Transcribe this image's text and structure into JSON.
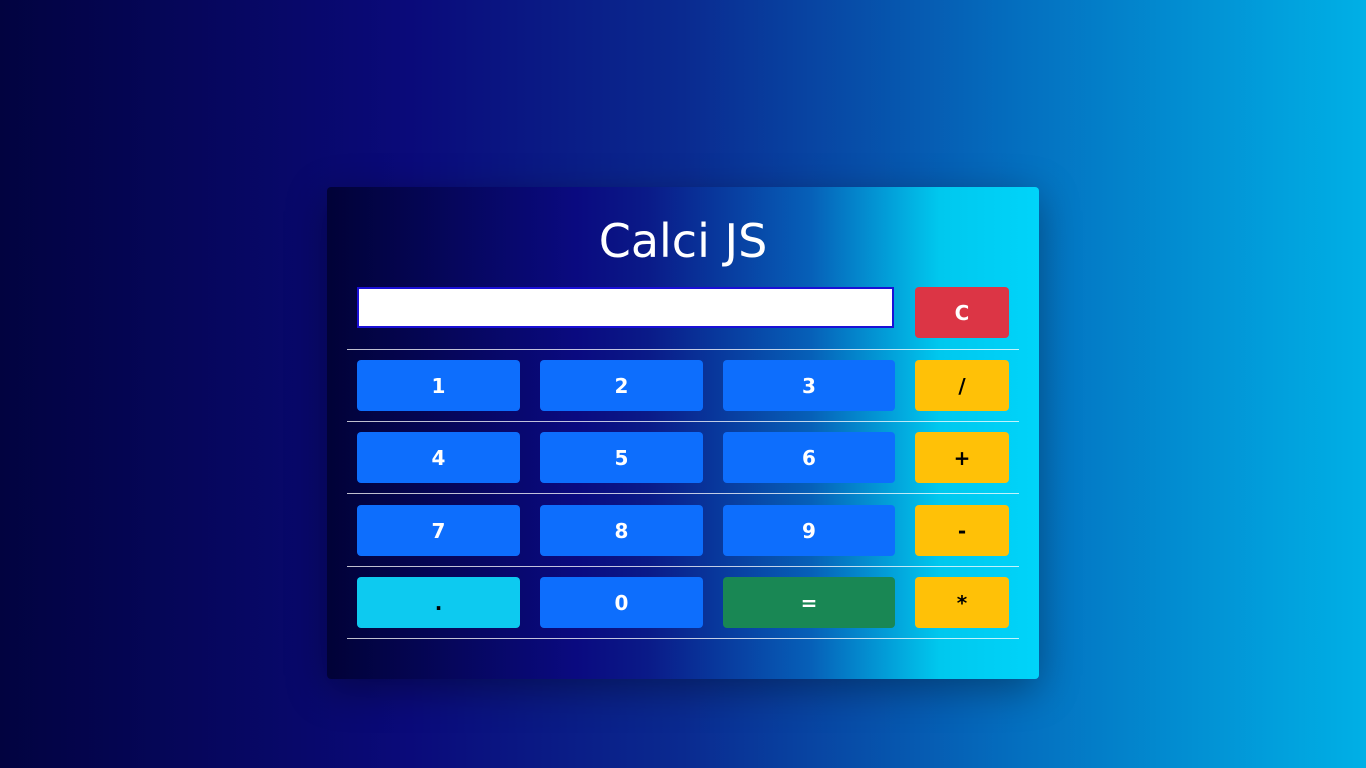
{
  "app": {
    "title": "Calci JS"
  },
  "display": {
    "value": ""
  },
  "buttons": {
    "clear": "C",
    "one": "1",
    "two": "2",
    "three": "3",
    "divide": "/",
    "four": "4",
    "five": "5",
    "six": "6",
    "plus": "+",
    "seven": "7",
    "eight": "8",
    "nine": "9",
    "minus": "-",
    "dot": ".",
    "zero": "0",
    "equals": "=",
    "multiply": "*"
  },
  "colors": {
    "number_button": "#0d6efd",
    "operator_button": "#ffc107",
    "clear_button": "#dc3545",
    "equals_button": "#198754",
    "dot_button": "#0dcaf0",
    "display_border": "#1a10d6"
  }
}
